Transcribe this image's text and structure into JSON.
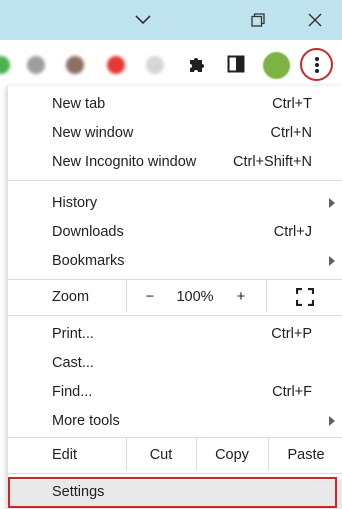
{
  "window": {
    "controls": [
      "chevron-down-icon",
      "restore-icon",
      "close-icon"
    ]
  },
  "toolbar": {
    "extensions": [
      {
        "icon": "extension-green-icon",
        "color": "#4caf50"
      },
      {
        "icon": "extension-grey-icon",
        "color": "#9e9e9e"
      },
      {
        "icon": "extension-brown-icon",
        "color": "#8d6e63"
      },
      {
        "icon": "extension-red-icon",
        "color": "#e53935"
      },
      {
        "icon": "extension-light-icon",
        "color": "#d6d6d6"
      }
    ],
    "profile_color": "#7cb342",
    "accent": "#d0262a"
  },
  "menu": {
    "new_tab": {
      "label": "New tab",
      "shortcut": "Ctrl+T"
    },
    "new_window": {
      "label": "New window",
      "shortcut": "Ctrl+N"
    },
    "new_incognito": {
      "label": "New Incognito window",
      "shortcut": "Ctrl+Shift+N"
    },
    "history": {
      "label": "History"
    },
    "downloads": {
      "label": "Downloads",
      "shortcut": "Ctrl+J"
    },
    "bookmarks": {
      "label": "Bookmarks"
    },
    "zoom": {
      "label": "Zoom",
      "minus": "−",
      "value": "100%",
      "plus": "+"
    },
    "print": {
      "label": "Print...",
      "shortcut": "Ctrl+P"
    },
    "cast": {
      "label": "Cast..."
    },
    "find": {
      "label": "Find...",
      "shortcut": "Ctrl+F"
    },
    "more_tools": {
      "label": "More tools"
    },
    "edit": {
      "label": "Edit",
      "cut": "Cut",
      "copy": "Copy",
      "paste": "Paste"
    },
    "settings": {
      "label": "Settings"
    }
  }
}
